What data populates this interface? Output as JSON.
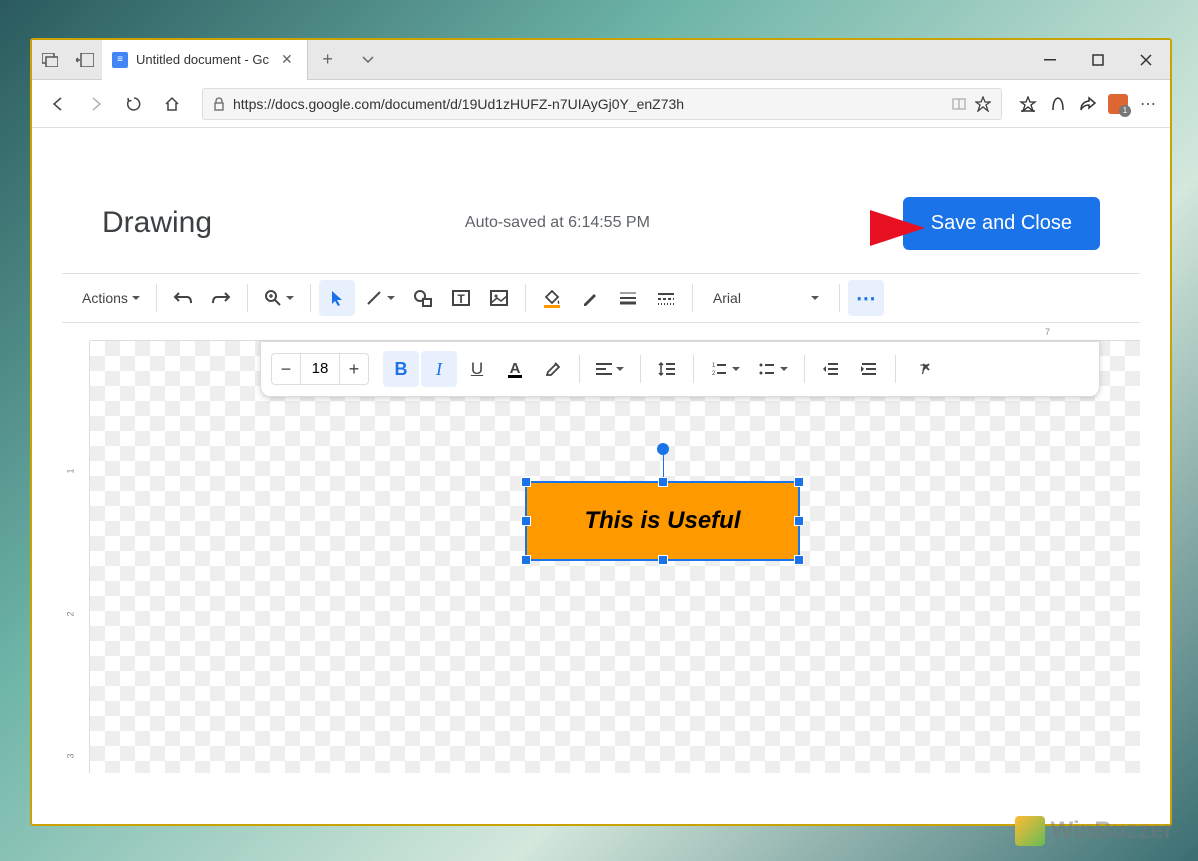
{
  "tab": {
    "title": "Untitled document - Gc"
  },
  "url": "https://docs.google.com/document/d/19Ud1zHUFZ-n7UIAyGj0Y_enZ73h",
  "dialog": {
    "title": "Drawing",
    "autosave": "Auto-saved at 6:14:55 PM",
    "save_button": "Save and Close"
  },
  "toolbar": {
    "actions": "Actions",
    "font": "Arial"
  },
  "text_toolbar": {
    "font_size": "18"
  },
  "shape": {
    "text": "This is Useful"
  },
  "ruler_v": [
    "1",
    "2",
    "3"
  ],
  "ruler_h": "7",
  "watermark": "WinBuzzer"
}
